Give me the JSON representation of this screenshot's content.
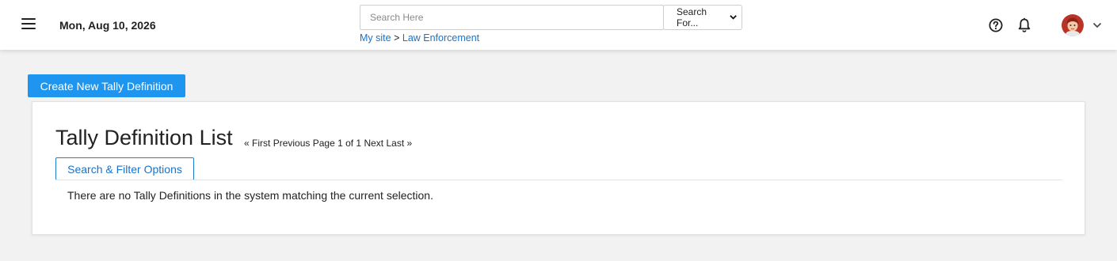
{
  "header": {
    "date": "Mon, Aug 10, 2026",
    "search": {
      "placeholder": "Search Here",
      "value": ""
    },
    "search_for": {
      "selected": "Search For..."
    },
    "breadcrumb": {
      "items": [
        "My site",
        "Law Enforcement"
      ],
      "separator": ">"
    },
    "icons": [
      "menu-icon",
      "help-icon",
      "bell-icon",
      "avatar",
      "chevron-down-icon"
    ]
  },
  "toolbar": {
    "create_label": "Create New Tally Definition"
  },
  "main": {
    "title": "Tally Definition List",
    "pager": {
      "first": "« First",
      "previous": "Previous",
      "page_info": "Page 1 of 1",
      "next": "Next",
      "last": "Last »"
    },
    "filter_label": "Search & Filter Options",
    "empty_message": "There are no Tally Definitions in the system matching the current selection."
  },
  "colors": {
    "accent": "#1e96f0",
    "link": "#1a73c8",
    "background": "#f2f2f2"
  }
}
